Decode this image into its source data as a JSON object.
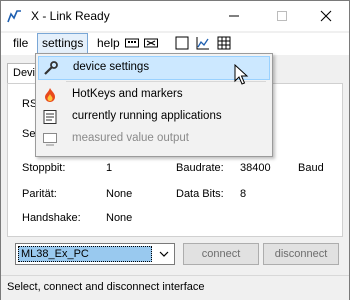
{
  "window": {
    "title": "X - Link Ready",
    "minimize_icon": "minimize-icon",
    "maximize_icon": "maximize-icon",
    "close_icon": "close-icon"
  },
  "menubar": {
    "file": "file",
    "settings": "settings",
    "help": "help",
    "toolbar_icons": [
      "keyboard-icon",
      "alert-icon",
      "square-icon",
      "chart-icon",
      "table-icon"
    ]
  },
  "tabs": {
    "device": "Devi"
  },
  "panel": {
    "rs_label": "RS",
    "se_label": "Se",
    "stopbit_label": "Stoppbit:",
    "stopbit_value": "1",
    "baudrate_label": "Baudrate:",
    "baudrate_value": "38400",
    "baud_unit": "Baud",
    "parity_label": "Parität:",
    "parity_value": "None",
    "databits_label": "Data Bits:",
    "databits_value": "8",
    "handshake_label": "Handshake:",
    "handshake_value": "None"
  },
  "bottom": {
    "combo_value": "ML38_Ex_PC",
    "connect": "connect",
    "disconnect": "disconnect"
  },
  "status": {
    "text": "Select, connect and disconnect interface"
  },
  "dropdown": {
    "items": [
      {
        "label": "device settings",
        "icon": "wrench-icon"
      },
      {
        "label": "HotKeys and markers",
        "icon": "fire-icon"
      },
      {
        "label": "currently running applications",
        "icon": "list-icon"
      },
      {
        "label": "measured value output",
        "icon": "output-icon"
      }
    ]
  },
  "colors": {
    "selection": "#99c9ef",
    "menu_highlight": "#cce8ff",
    "accent_blue": "#1e5fb0"
  }
}
